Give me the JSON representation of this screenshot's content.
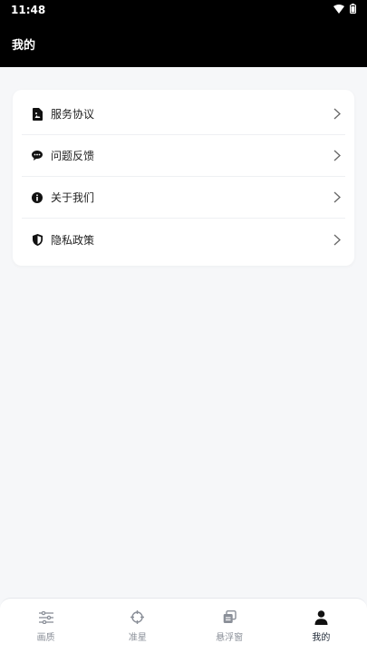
{
  "status_bar": {
    "time": "11:48",
    "wifi_icon": "wifi-icon",
    "battery_icon": "battery-icon"
  },
  "app_bar": {
    "title": "我的"
  },
  "menu": {
    "items": [
      {
        "label": "服务协议",
        "icon": "document-icon"
      },
      {
        "label": "问题反馈",
        "icon": "chat-bubble-icon"
      },
      {
        "label": "关于我们",
        "icon": "info-icon"
      },
      {
        "label": "隐私政策",
        "icon": "shield-icon"
      }
    ]
  },
  "tab_bar": {
    "active_index": 3,
    "tabs": [
      {
        "label": "画质",
        "icon": "sliders-icon"
      },
      {
        "label": "准星",
        "icon": "crosshair-icon"
      },
      {
        "label": "悬浮窗",
        "icon": "floating-window-icon"
      },
      {
        "label": "我的",
        "icon": "person-icon"
      }
    ]
  },
  "colors": {
    "background": "#f6f7f9",
    "header": "#000000",
    "card": "#ffffff",
    "inactive_tab": "#8a8f98"
  }
}
